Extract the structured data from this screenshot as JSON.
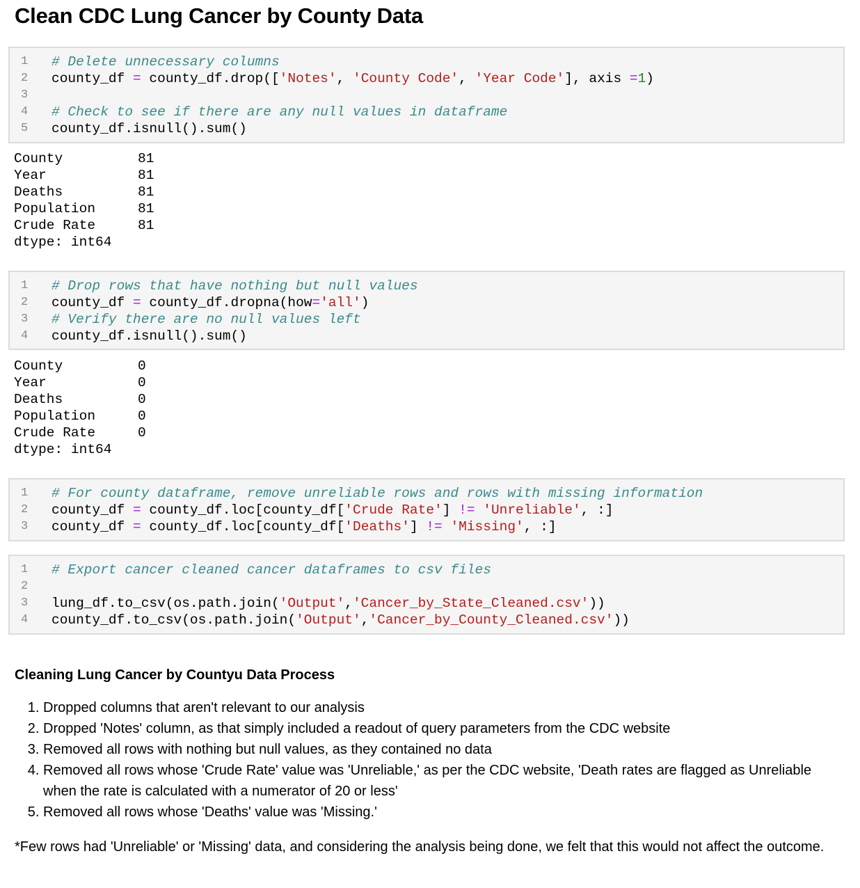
{
  "title": "Clean CDC Lung Cancer by County Data",
  "cells": [
    {
      "lines": [
        {
          "n": "1",
          "parts": [
            {
              "t": "# Delete unnecessary columns",
              "c": "cm"
            }
          ]
        },
        {
          "n": "2",
          "parts": [
            {
              "t": "county_df ",
              "c": ""
            },
            {
              "t": "=",
              "c": "op"
            },
            {
              "t": " county_df.drop([",
              "c": ""
            },
            {
              "t": "'Notes'",
              "c": "st"
            },
            {
              "t": ", ",
              "c": ""
            },
            {
              "t": "'County Code'",
              "c": "st"
            },
            {
              "t": ", ",
              "c": ""
            },
            {
              "t": "'Year Code'",
              "c": "st"
            },
            {
              "t": "], axis ",
              "c": ""
            },
            {
              "t": "=",
              "c": "op"
            },
            {
              "t": "1",
              "c": "nm"
            },
            {
              "t": ")",
              "c": ""
            }
          ]
        },
        {
          "n": "3",
          "parts": []
        },
        {
          "n": "4",
          "parts": [
            {
              "t": "# Check to see if there are any null values in dataframe",
              "c": "cm"
            }
          ]
        },
        {
          "n": "5",
          "parts": [
            {
              "t": "county_df.isnull().sum()",
              "c": ""
            }
          ]
        }
      ]
    },
    {
      "lines": [
        {
          "n": "1",
          "parts": [
            {
              "t": "# Drop rows that have nothing but null values",
              "c": "cm"
            }
          ]
        },
        {
          "n": "2",
          "parts": [
            {
              "t": "county_df ",
              "c": ""
            },
            {
              "t": "=",
              "c": "op"
            },
            {
              "t": " county_df.dropna(how",
              "c": ""
            },
            {
              "t": "=",
              "c": "op"
            },
            {
              "t": "'all'",
              "c": "st"
            },
            {
              "t": ")",
              "c": ""
            }
          ]
        },
        {
          "n": "3",
          "parts": [
            {
              "t": "# Verify there are no null values left",
              "c": "cm"
            }
          ]
        },
        {
          "n": "4",
          "parts": [
            {
              "t": "county_df.isnull().sum()",
              "c": ""
            }
          ]
        }
      ]
    },
    {
      "lines": [
        {
          "n": "1",
          "parts": [
            {
              "t": "# For county dataframe, remove unreliable rows and rows with missing information",
              "c": "cm"
            }
          ]
        },
        {
          "n": "2",
          "parts": [
            {
              "t": "county_df ",
              "c": ""
            },
            {
              "t": "=",
              "c": "op"
            },
            {
              "t": " county_df.loc[county_df[",
              "c": ""
            },
            {
              "t": "'Crude Rate'",
              "c": "st"
            },
            {
              "t": "] ",
              "c": ""
            },
            {
              "t": "!=",
              "c": "op"
            },
            {
              "t": " ",
              "c": ""
            },
            {
              "t": "'Unreliable'",
              "c": "st"
            },
            {
              "t": ", :]",
              "c": ""
            }
          ]
        },
        {
          "n": "3",
          "parts": [
            {
              "t": "county_df ",
              "c": ""
            },
            {
              "t": "=",
              "c": "op"
            },
            {
              "t": " county_df.loc[county_df[",
              "c": ""
            },
            {
              "t": "'Deaths'",
              "c": "st"
            },
            {
              "t": "] ",
              "c": ""
            },
            {
              "t": "!=",
              "c": "op"
            },
            {
              "t": " ",
              "c": ""
            },
            {
              "t": "'Missing'",
              "c": "st"
            },
            {
              "t": ", :]",
              "c": ""
            }
          ]
        }
      ]
    },
    {
      "lines": [
        {
          "n": "1",
          "parts": [
            {
              "t": "# Export cancer cleaned cancer dataframes to csv files",
              "c": "cm"
            }
          ]
        },
        {
          "n": "2",
          "parts": []
        },
        {
          "n": "3",
          "parts": [
            {
              "t": "lung_df.to_csv(os.path.join(",
              "c": ""
            },
            {
              "t": "'Output'",
              "c": "st"
            },
            {
              "t": ",",
              "c": ""
            },
            {
              "t": "'Cancer_by_State_Cleaned.csv'",
              "c": "st"
            },
            {
              "t": "))",
              "c": ""
            }
          ]
        },
        {
          "n": "4",
          "parts": [
            {
              "t": "county_df.to_csv(os.path.join(",
              "c": ""
            },
            {
              "t": "'Output'",
              "c": "st"
            },
            {
              "t": ",",
              "c": ""
            },
            {
              "t": "'Cancer_by_County_Cleaned.csv'",
              "c": "st"
            },
            {
              "t": "))",
              "c": ""
            }
          ]
        }
      ]
    }
  ],
  "outputs": [
    {
      "rows": [
        {
          "k": "County",
          "v": "81"
        },
        {
          "k": "Year",
          "v": "81"
        },
        {
          "k": "Deaths",
          "v": "81"
        },
        {
          "k": "Population",
          "v": "81"
        },
        {
          "k": "Crude Rate",
          "v": "81"
        }
      ],
      "dtype": "dtype: int64"
    },
    {
      "rows": [
        {
          "k": "County",
          "v": "0"
        },
        {
          "k": "Year",
          "v": "0"
        },
        {
          "k": "Deaths",
          "v": "0"
        },
        {
          "k": "Population",
          "v": "0"
        },
        {
          "k": "Crude Rate",
          "v": "0"
        }
      ],
      "dtype": "dtype: int64"
    }
  ],
  "markdown": {
    "heading": "Cleaning Lung Cancer by Countyu Data Process",
    "items": [
      "Dropped columns that aren't relevant to our analysis",
      "Dropped 'Notes' column, as that simply included a readout of query parameters from the CDC website",
      "Removed all rows with nothing but null values, as they contained no data",
      "Removed all rows whose 'Crude Rate' value was 'Unreliable,' as per the CDC website, 'Death rates are flagged as Unreliable when the rate is calculated with a numerator of 20 or less'",
      "Removed all rows whose 'Deaths' value was 'Missing.'"
    ],
    "note": "*Few rows had 'Unreliable' or 'Missing' data, and considering the analysis being done, we felt that this would not affect the outcome."
  }
}
